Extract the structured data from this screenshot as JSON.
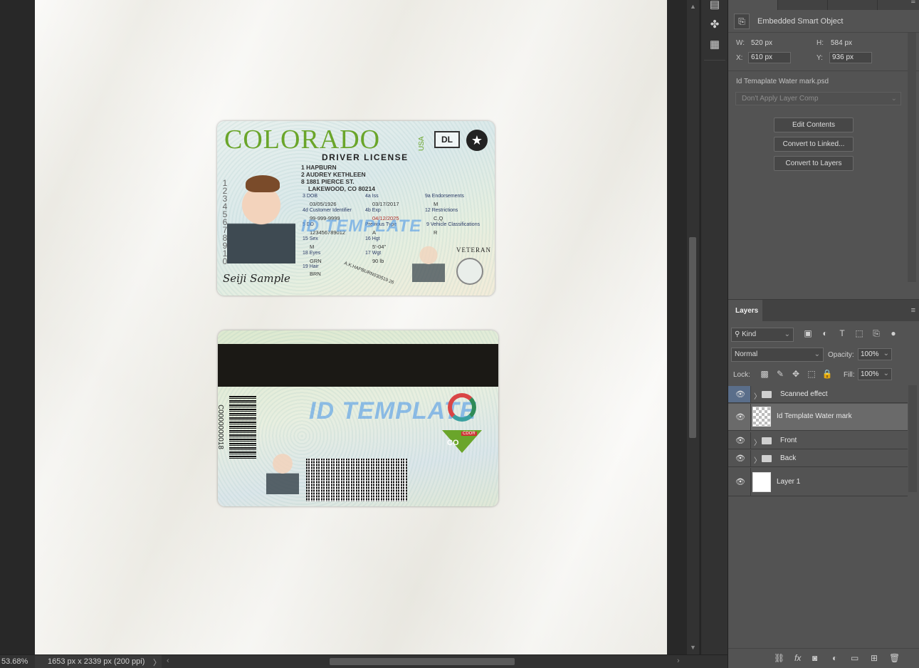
{
  "status_bar": {
    "zoom": "53.68%",
    "doc_info": "1653 px x 2339 px (200 ppi)"
  },
  "tools": [
    "properties-icon",
    "adjustments-icon",
    "grid-icon"
  ],
  "properties": {
    "object_type": "Embedded Smart Object",
    "w_label": "W:",
    "w_value": "520 px",
    "h_label": "H:",
    "h_value": "584 px",
    "x_label": "X:",
    "x_value": "610 px",
    "y_label": "Y:",
    "y_value": "936 px",
    "linked_file": "Id Temaplate Water mark.psd",
    "layer_comp": "Don't Apply Layer Comp",
    "buttons": {
      "edit": "Edit Contents",
      "convert_linked": "Convert to Linked...",
      "convert_layers": "Convert to Layers"
    }
  },
  "layers_panel": {
    "tab": "Layers",
    "kind": "Kind",
    "blend_mode": "Normal",
    "opacity_label": "Opacity:",
    "opacity": "100%",
    "lock_label": "Lock:",
    "fill_label": "Fill:",
    "fill": "100%",
    "layers": [
      {
        "name": "Scanned effect",
        "type": "group",
        "selected": false
      },
      {
        "name": "Id Template Water mark",
        "type": "smart-object",
        "selected": true
      },
      {
        "name": "Front",
        "type": "group",
        "selected": false
      },
      {
        "name": "Back",
        "type": "group",
        "selected": false
      },
      {
        "name": "Layer 1",
        "type": "layer",
        "selected": false
      }
    ]
  },
  "id_front": {
    "state": "COLORADO",
    "country": "USA",
    "class": "DL",
    "subtitle": "DRIVER LICENSE",
    "lines": [
      "1 HAPBURN",
      "2 AUDREY KETHLEEN",
      "8 1881 PIERCE ST.",
      "LAKEWOOD, CO 80214"
    ],
    "dob_label": "3 DOB",
    "dob": "03/05/1926",
    "iss_label": "4a Iss",
    "iss": "03/17/2017",
    "customer_label": "4d Customer Identifier",
    "customer": "99-999-9999",
    "exp_label": "4b Exp",
    "exp": "04/12/2025",
    "dd_label": "5 DD",
    "dd": "123456789012",
    "prev_label": "Previous Type",
    "prev": "A",
    "end_label": "9a Endorsements",
    "end": "M",
    "restr_label": "12 Restrictions",
    "restr": "C,Q",
    "vc_label": "9 Vehicle Classifications",
    "vc": "R",
    "sex_label": "15 Sex",
    "sex": "M",
    "hgt_label": "16 Hgt",
    "hgt": "5'-04\"",
    "eyes_label": "18 Eyes",
    "eyes": "GRN",
    "wgt_label": "17 Wgt",
    "wgt": "90 lb",
    "hair_label": "19 Hair",
    "hair": "BRN",
    "digits": "12345678910",
    "signature": "Seiji Sample",
    "veteran": "VETERAN",
    "curve_text": "A.K.HAPBURN030519 26",
    "watermark": "ID TEMPLATE"
  },
  "id_back": {
    "watermark": "ID TEMPLATE",
    "barcode_number": "C0000000018",
    "badge": "CO",
    "cdor": "CDOR"
  }
}
